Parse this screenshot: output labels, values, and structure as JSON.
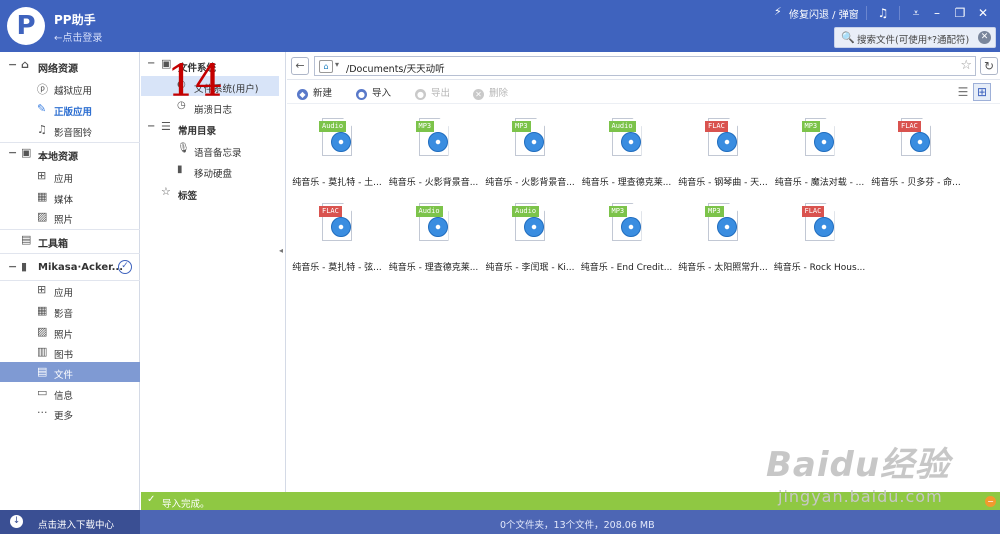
{
  "app": {
    "title": "PP助手",
    "login_hint": "←点击登录",
    "fix_label": "修复闪退 / 弹窗"
  },
  "search": {
    "placeholder": "搜索文件(可使用*?通配符)"
  },
  "sidebar": {
    "sections": [
      {
        "label": "网络资源",
        "items": [
          {
            "label": "越狱应用",
            "icon": "pp-icon"
          },
          {
            "label": "正版应用",
            "icon": "appstore-icon"
          },
          {
            "label": "影音图铃",
            "icon": "music-icon"
          }
        ]
      },
      {
        "label": "本地资源",
        "items": [
          {
            "label": "应用",
            "icon": "apps-grid-icon"
          },
          {
            "label": "媒体",
            "icon": "media-icon"
          },
          {
            "label": "照片",
            "icon": "photo-icon"
          }
        ]
      },
      {
        "label": "工具箱",
        "items": []
      },
      {
        "label": "Mikasa·Acker...",
        "items": [
          {
            "label": "应用",
            "icon": "apps-grid-icon"
          },
          {
            "label": "影音",
            "icon": "film-icon"
          },
          {
            "label": "照片",
            "icon": "photo-icon"
          },
          {
            "label": "图书",
            "icon": "book-icon"
          },
          {
            "label": "文件",
            "icon": "file-icon"
          },
          {
            "label": "信息",
            "icon": "message-icon"
          },
          {
            "label": "更多",
            "icon": "more-icon"
          }
        ]
      }
    ]
  },
  "tree": {
    "file_system": "文件系统",
    "file_system_items": [
      "文件系统(用户)",
      "崩溃日志"
    ],
    "common_dirs": "常用目录",
    "common_items": [
      "语音备忘录",
      "移动硬盘"
    ],
    "tags": "标签"
  },
  "annotation": {
    "step": "14"
  },
  "address": {
    "path": "/Documents/天天动听"
  },
  "toolbar": {
    "new": "新建",
    "import": "导入",
    "export": "导出",
    "delete": "删除"
  },
  "colors": {
    "audio": "#7cc34a",
    "mp3": "#7cc34a",
    "flac": "#d9534f",
    "accent": "#3f63be"
  },
  "files": [
    {
      "name": "纯音乐 - 莫扎特 - 土...",
      "format": "Audio"
    },
    {
      "name": "纯音乐 - 火影背景音...",
      "format": "MP3"
    },
    {
      "name": "纯音乐 - 火影背景音...",
      "format": "MP3"
    },
    {
      "name": "纯音乐 - 理查德克莱...",
      "format": "Audio"
    },
    {
      "name": "纯音乐 - 钢琴曲 - 天...",
      "format": "FLAC"
    },
    {
      "name": "纯音乐 - 魔法对载 - ...",
      "format": "MP3"
    },
    {
      "name": "纯音乐 - 贝多芬 - 命...",
      "format": "FLAC"
    },
    {
      "name": "纯音乐 - 莫扎特 - 弦...",
      "format": "FLAC"
    },
    {
      "name": "纯音乐 - 理查德克莱...",
      "format": "Audio"
    },
    {
      "name": "纯音乐 - 李闰珉 - Ki...",
      "format": "Audio"
    },
    {
      "name": "纯音乐 - End Credit...",
      "format": "MP3"
    },
    {
      "name": "纯音乐 - 太阳照常升...",
      "format": "MP3"
    },
    {
      "name": "纯音乐 - Rock Hous...",
      "format": "FLAC"
    }
  ],
  "status": {
    "message": "导入完成。",
    "summary": "0个文件夹，13个文件，208.06 MB"
  },
  "bottom": {
    "download_center": "点击进入下载中心"
  },
  "watermark": {
    "brand": "Baidu经验",
    "url": "jingyan.baidu.com"
  }
}
